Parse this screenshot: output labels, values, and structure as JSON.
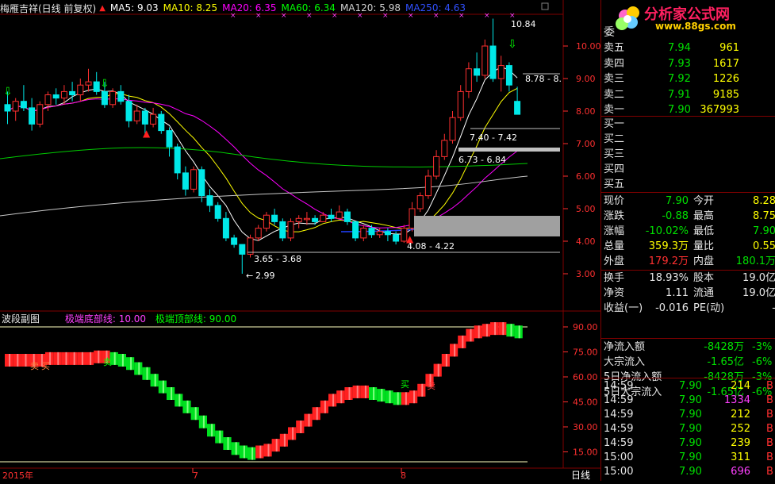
{
  "main_header": {
    "stock": "梅雁吉祥(日线 前复权)",
    "ma": [
      {
        "label": "MA5: 9.03",
        "color": "#ffffff"
      },
      {
        "label": "MA10: 8.25",
        "color": "#ffff00"
      },
      {
        "label": "MA20: 6.35",
        "color": "#ff00ff"
      },
      {
        "label": "MA60: 6.34",
        "color": "#00ff00"
      },
      {
        "label": "MA120: 5.98",
        "color": "#d0d0d0"
      },
      {
        "label": "MA250: 4.63",
        "color": "#3050ff"
      }
    ]
  },
  "price_axis": [
    "10.00",
    "9.00",
    "8.00",
    "7.00",
    "6.00",
    "5.00",
    "4.00",
    "3.00"
  ],
  "annotations": {
    "high": "10.84",
    "r1": "8.78 - 8.",
    "r2": "7.40 - 7.42",
    "r3": "6.73 - 6.84",
    "r4": "4.08 - 4.22",
    "r5": "3.65 - 3.68",
    "low": "2.99"
  },
  "sub_header": {
    "title": "波段副图",
    "bottom_line": "极端底部线: 10.00",
    "top_line": "极端顶部线: 90.00"
  },
  "sub_axis": [
    "90.00",
    "75.00",
    "60.00",
    "45.00",
    "30.00",
    "15.00"
  ],
  "sub_marks": {
    "sell1": "卖",
    "buy1": "买",
    "sell2": "卖",
    "buy2": "买",
    "sell3": "卖"
  },
  "x_axis": {
    "year": "2015年",
    "m7": "7",
    "m8": "8",
    "period": "日线"
  },
  "logo": {
    "text": "分析家公式网",
    "url": "www.88gs.com"
  },
  "orderbook": {
    "title_char": "委",
    "sells": [
      {
        "label": "卖五",
        "price": "7.94",
        "vol": "961"
      },
      {
        "label": "卖四",
        "price": "7.93",
        "vol": "1617"
      },
      {
        "label": "卖三",
        "price": "7.92",
        "vol": "1226"
      },
      {
        "label": "卖二",
        "price": "7.91",
        "vol": "9185"
      },
      {
        "label": "卖一",
        "price": "7.90",
        "vol": "367993"
      }
    ],
    "buys": [
      "买一",
      "买二",
      "买三",
      "买四",
      "买五"
    ]
  },
  "quote": [
    {
      "l": "现价",
      "v": "7.90",
      "vc": "#00e000",
      "l2": "今开",
      "v2": "8.28",
      "v2c": "#ffff00"
    },
    {
      "l": "涨跌",
      "v": "-0.88",
      "vc": "#00e000",
      "l2": "最高",
      "v2": "8.75",
      "v2c": "#ffff00"
    },
    {
      "l": "涨幅",
      "v": "-10.02%",
      "vc": "#00e000",
      "l2": "最低",
      "v2": "7.90",
      "v2c": "#00e000"
    },
    {
      "l": "总量",
      "v": "359.3万",
      "vc": "#ffff00",
      "l2": "量比",
      "v2": "0.55",
      "v2c": "#ffff00"
    },
    {
      "l": "外盘",
      "v": "179.2万",
      "vc": "#ff3030",
      "l2": "内盘",
      "v2": "180.1万",
      "v2c": "#00e000"
    }
  ],
  "stats": [
    {
      "l": "换手",
      "v": "18.93%",
      "l2": "股本",
      "v2": "19.0亿"
    },
    {
      "l": "净资",
      "v": "1.11",
      "l2": "流通",
      "v2": "19.0亿"
    },
    {
      "l": "收益(一)",
      "v": "-0.016",
      "l2": "PE(动)",
      "v2": "-"
    }
  ],
  "flows": [
    {
      "l": "净流入额",
      "v": "-8428万",
      "p": "-3%"
    },
    {
      "l": "大宗流入",
      "v": "-1.65亿",
      "p": "-6%"
    },
    {
      "l": "5日净流入额",
      "v": "-8428万",
      "p": "-3%"
    },
    {
      "l": "5日大宗流入",
      "v": "-1.65亿",
      "p": "-6%"
    }
  ],
  "ticks": [
    {
      "t": "14:59",
      "p": "7.90",
      "v": "214",
      "s": "B",
      "vc": "#ffff00"
    },
    {
      "t": "14:59",
      "p": "7.90",
      "v": "1334",
      "s": "B",
      "vc": "#ff40ff"
    },
    {
      "t": "14:59",
      "p": "7.90",
      "v": "212",
      "s": "B",
      "vc": "#ffff00"
    },
    {
      "t": "14:59",
      "p": "7.90",
      "v": "252",
      "s": "B",
      "vc": "#ffff00"
    },
    {
      "t": "14:59",
      "p": "7.90",
      "v": "239",
      "s": "B",
      "vc": "#ffff00"
    },
    {
      "t": "15:00",
      "p": "7.90",
      "v": "311",
      "s": "B",
      "vc": "#ffff00"
    },
    {
      "t": "15:00",
      "p": "7.90",
      "v": "696",
      "s": "B",
      "vc": "#ff40ff"
    }
  ]
}
